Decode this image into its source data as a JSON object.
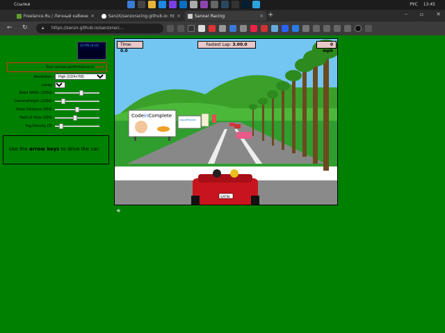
{
  "taskbar": {
    "title": "Ссылки",
    "lang": "РУС",
    "time": "13:45"
  },
  "tabs": [
    {
      "label": "Freelance.Ru / Личный кабинет",
      "icon": "freelance-icon"
    },
    {
      "label": "SanzX/sanzxracing.github.io: http",
      "icon": "github-icon"
    },
    {
      "label": "Sanxar Racing",
      "icon": "page-icon"
    }
  ],
  "url": "https://sanzx.github.io/sanzxraci...",
  "fps": "13 FPS (0-15)",
  "perf": {
    "text": "Your canvas performance is",
    "value": "good"
  },
  "controls": {
    "resolution_label": "Resolution :",
    "resolution_value": "High (1024x768)",
    "lanes_label": "Lanes :",
    "lanes_value": "3",
    "road_width_label": "Road Width (2000) :",
    "camera_height_label": "CameraHeight (1000) :",
    "draw_distance_label": "Draw Distance (300) :",
    "field_of_view_label": "Field of View (100) :",
    "fog_density_label": "Fog Density (5) :",
    "road_width_value": 0.6,
    "camera_height_value": 0.15,
    "draw_distance_value": 0.5,
    "field_of_view_value": 0.45,
    "fog_density_value": 0.1
  },
  "instructions": {
    "prefix": "Use the",
    "keys": "arrow keys",
    "suffix": "to drive the car."
  },
  "hud": {
    "time_label": "Time:",
    "time_value": "0.0",
    "fastest_label": "Fastest Lap:",
    "fastest_value": "3.00.0",
    "speed": "0 mph"
  },
  "billboards": {
    "code_a": "Code",
    "code_b": "in",
    "code_c": "Complete",
    "liquid": "LiquidPlanner",
    "plate": "SATIN"
  }
}
